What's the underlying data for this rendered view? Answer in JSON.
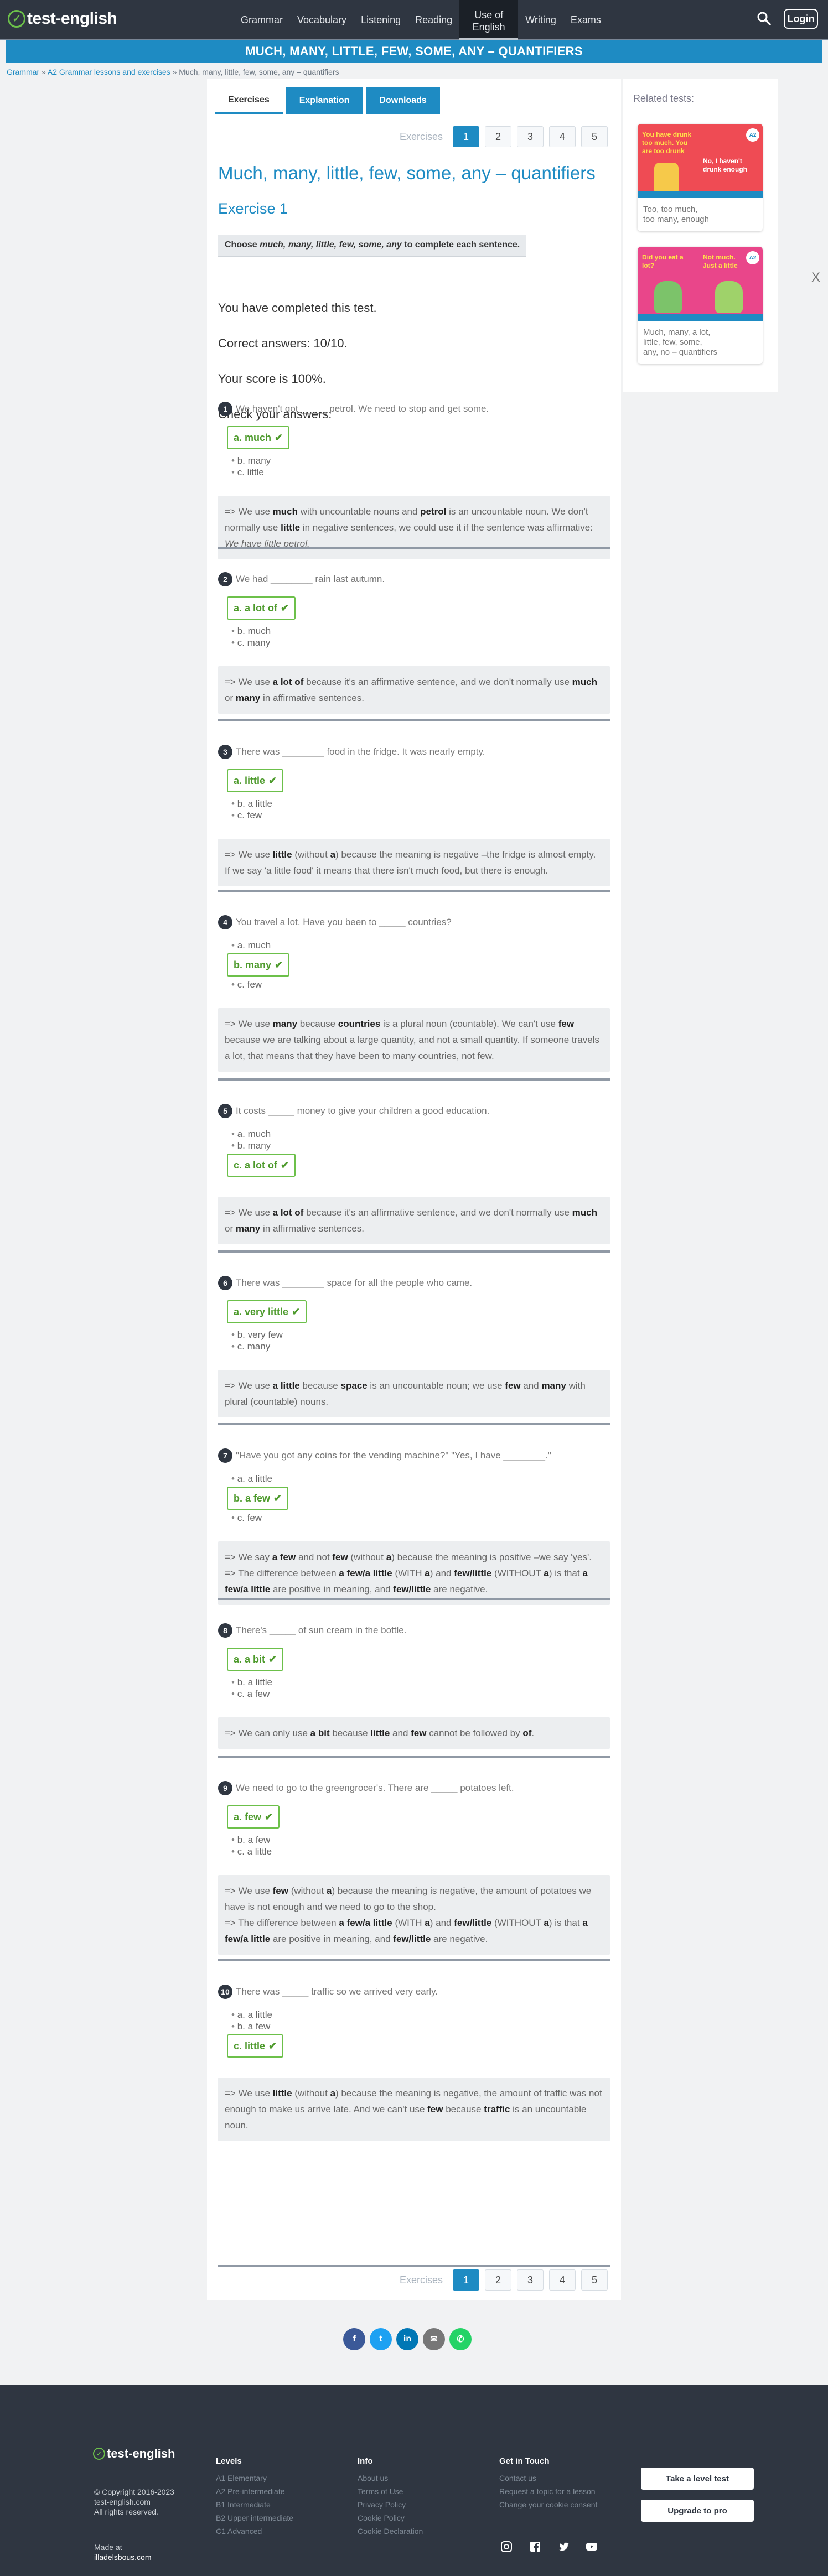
{
  "nav": {
    "logo": "test-english",
    "items": [
      "Grammar",
      "Vocabulary",
      "Listening",
      "Reading",
      "Use of\nEnglish",
      "Writing",
      "Exams"
    ],
    "login": "Login"
  },
  "title_bar": "MUCH, MANY, LITTLE, FEW, SOME, ANY – QUANTIFIERS",
  "breadcrumb": {
    "items": [
      "Grammar",
      "A2 Grammar lessons and exercises"
    ],
    "current": "Much, many, little, few, some, any – quantifiers",
    "sep": " » "
  },
  "tabs": [
    "Exercises",
    "Explanation",
    "Downloads"
  ],
  "pager": {
    "label": "Exercises",
    "pages": [
      "1",
      "2",
      "3",
      "4",
      "5"
    ],
    "active": "1"
  },
  "heading": "Much, many, little, few, some, any – quantifiers",
  "exercise_title": "Exercise 1",
  "instruction": "Choose much, many, little, few, some, any to complete each sentence.",
  "result": {
    "completed": "You have completed this test.",
    "correct": "Correct answers: 10/10.",
    "score": "Your score is 100%.",
    "check": "Check your answers:"
  },
  "questions": [
    {
      "num": "1",
      "text": "We haven't got _____ petrol. We need to stop and get some.",
      "options": [
        "a. much",
        "b. many",
        "c. little"
      ],
      "correct": 0,
      "expl": "=> We use <b>much</b> with uncountable nouns and <b>petrol</b> is an uncountable noun. We don't normally use <b>little</b> in negative sentences, we could use it if the sentence was affirmative: <i>We have little petrol.</i>"
    },
    {
      "num": "2",
      "text": "We had ________ rain last autumn.",
      "options": [
        "a. a lot of",
        "b. much",
        "c. many"
      ],
      "correct": 0,
      "expl": "=> We use <b>a lot of</b> because it's an affirmative sentence, and we don't normally use <b>much</b> or <b>many</b> in affirmative sentences."
    },
    {
      "num": "3",
      "text": "There was ________ food in the fridge. It was nearly empty.",
      "options": [
        "a. little",
        "b. a little",
        "c. few"
      ],
      "correct": 0,
      "expl": "=> We use <b>little</b> (without <b>a</b>) because the meaning is negative –the fridge is almost empty. If we say 'a little food' it means that there isn't much food, but there is enough."
    },
    {
      "num": "4",
      "text": "You travel a lot. Have you been to _____ countries?",
      "options": [
        "a. much",
        "b. many",
        "c. few"
      ],
      "correct": 1,
      "expl": "=> We use <b>many</b> because <b>countries</b> is a plural noun (countable). We can't use <b>few</b> because we are talking about a large quantity, and not a small quantity. If someone travels a lot, that means that they have been to many countries, not few."
    },
    {
      "num": "5",
      "text": "It costs _____ money to give your children a good education.",
      "options": [
        "a. much",
        "b. many",
        "c. a lot of"
      ],
      "correct": 2,
      "expl": "=> We use <b>a lot of</b> because it's an affirmative sentence, and we don't normally use <b>much</b> or <b>many</b> in affirmative sentences."
    },
    {
      "num": "6",
      "text": "There was ________ space for all the people who came.",
      "options": [
        "a. very little",
        "b. very few",
        "c. many"
      ],
      "correct": 0,
      "expl": "=> We use <b>a little</b> because <b>space</b> is an uncountable noun; we use <b>few</b> and <b>many</b> with plural (countable) nouns."
    },
    {
      "num": "7",
      "text": "\"Have you got any coins for the vending machine?\" \"Yes, I have ________.\"",
      "options": [
        "a. a little",
        "b. a few",
        "c. few"
      ],
      "correct": 1,
      "expl": "=> We say <b>a few</b> and not <b>few</b> (without <b>a</b>) because the meaning is positive –we say 'yes'.<br>=> The difference between <b>a few/a little</b> (WITH <b>a</b>) and <b>few/little</b> (WITHOUT <b>a</b>) is that <b>a few/a little</b> are positive in meaning, and <b>few/little</b> are negative."
    },
    {
      "num": "8",
      "text": "There's _____ of sun cream in the bottle.",
      "options": [
        "a. a bit",
        "b. a little",
        "c. a few"
      ],
      "correct": 0,
      "expl": "=> We can only use <b>a bit</b> because <b>little</b> and <b>few</b> cannot be followed by <b>of</b>."
    },
    {
      "num": "9",
      "text": "We need to go to the greengrocer's. There are _____ potatoes left.",
      "options": [
        "a. few",
        "b. a few",
        "c. a little"
      ],
      "correct": 0,
      "expl": "=> We use <b>few</b> (without <b>a</b>) because the meaning is negative, the amount of potatoes we have is not enough and we need to go to the shop.<br>=> The difference between <b>a few/a little</b> (WITH <b>a</b>) and <b>few/little</b> (WITHOUT <b>a</b>) is that <b>a few/a little</b> are positive in meaning, and <b>few/little</b> are negative."
    },
    {
      "num": "10",
      "text": "There was _____ traffic so we arrived very early.",
      "options": [
        "a. a little",
        "b. a few",
        "c. little"
      ],
      "correct": 2,
      "expl": "=> We use <b>little</b> (without <b>a</b>) because the meaning is negative, the amount of traffic was not enough to make us arrive late. And we can't use <b>few</b> because <b>traffic</b> is an uncountable noun."
    }
  ],
  "sidebar": {
    "title": "Related tests:",
    "cards": [
      {
        "caption": "Too, too much,\ntoo many, enough",
        "img_text1": "You have drunk too much. You are too drunk",
        "img_text2": "No, I haven't drunk enough",
        "badge": "A2"
      },
      {
        "caption": "Much, many, a lot,\nlittle, few, some,\nany, no – quantifiers",
        "img_text1": "Did you eat a lot?",
        "img_text2": "Not much. Just a little",
        "badge": "A2"
      }
    ]
  },
  "close": "X",
  "footer": {
    "logo": "test-english",
    "copyright": "© Copyright 2016-2023",
    "site": "test-english.com",
    "rights": "All rights reserved.",
    "made_at": "Made at",
    "madeby": "illadelsbous.com",
    "levels_title": "Levels",
    "levels": [
      "A1 Elementary",
      "A2 Pre-intermediate",
      "B1 Intermediate",
      "B2 Upper intermediate",
      "C1 Advanced"
    ],
    "info_title": "Info",
    "info": [
      "About us",
      "Terms of Use",
      "Privacy Policy",
      "Cookie Policy",
      "Cookie Declaration"
    ],
    "contact_title": "Get in Touch",
    "contact": [
      "Contact us",
      "Request a topic for a lesson",
      "Change your cookie consent"
    ],
    "btn_level": "Take a level test",
    "btn_pro": "Upgrade to pro"
  },
  "colors": {
    "brand": "#1e8bc3",
    "correct": "#6cc04a",
    "dark": "#2f3641"
  }
}
